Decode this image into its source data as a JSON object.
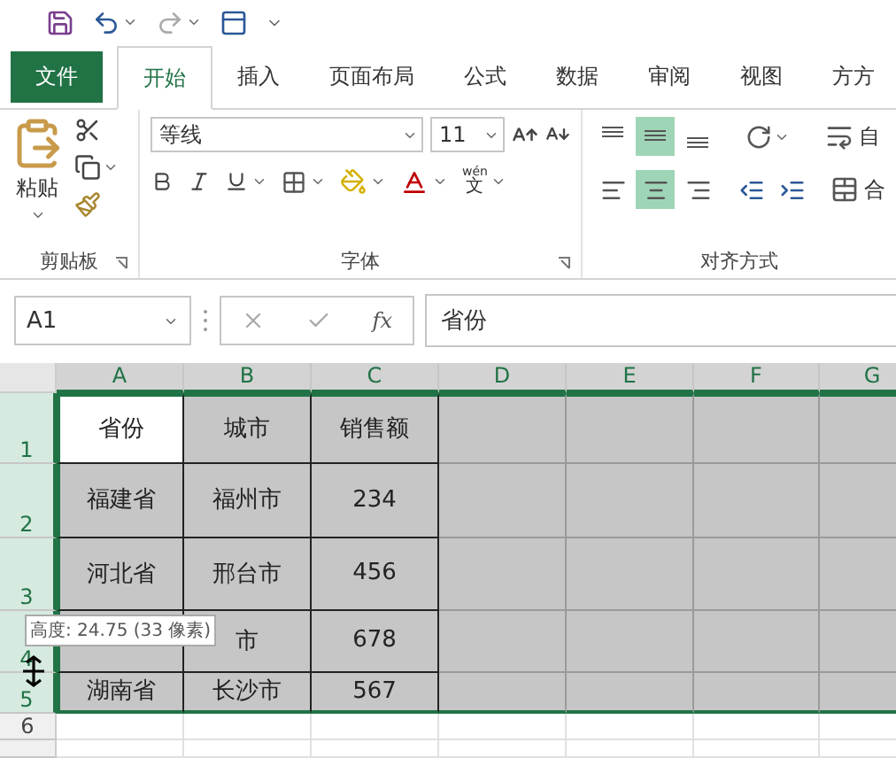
{
  "tabs": [
    {
      "label": "文件",
      "kind": "file",
      "selected": false
    },
    {
      "label": "开始",
      "kind": "tab",
      "selected": true
    },
    {
      "label": "插入",
      "kind": "tab",
      "selected": false
    },
    {
      "label": "页面布局",
      "kind": "tab",
      "selected": false
    },
    {
      "label": "公式",
      "kind": "tab",
      "selected": false
    },
    {
      "label": "数据",
      "kind": "tab",
      "selected": false
    },
    {
      "label": "审阅",
      "kind": "tab",
      "selected": false
    },
    {
      "label": "视图",
      "kind": "tab",
      "selected": false
    },
    {
      "label": "方方",
      "kind": "tab",
      "selected": false
    }
  ],
  "ribbon": {
    "clipboard": {
      "paste_label": "粘贴",
      "group_label": "剪贴板"
    },
    "font": {
      "font_name": "等线",
      "font_size": "11",
      "phonetic_top": "wén",
      "phonetic_bottom": "文",
      "group_label": "字体"
    },
    "alignment": {
      "vertical": [
        {
          "selected": false
        },
        {
          "selected": true
        },
        {
          "selected": false
        }
      ],
      "horizontal": [
        {
          "selected": false
        },
        {
          "selected": true
        },
        {
          "selected": false
        }
      ],
      "wrap_label": "自",
      "merge_label": "合",
      "group_label": "对齐方式"
    }
  },
  "formula_bar": {
    "name_box": "A1",
    "function_symbol": "fx",
    "formula": "省份"
  },
  "sheet": {
    "columns": [
      {
        "label": "A",
        "selected": true
      },
      {
        "label": "B",
        "selected": true
      },
      {
        "label": "C",
        "selected": true
      },
      {
        "label": "D",
        "selected": true
      },
      {
        "label": "E",
        "selected": true
      },
      {
        "label": "F",
        "selected": true
      },
      {
        "label": "G",
        "selected": true
      }
    ],
    "rows": [
      {
        "header": "1",
        "selected": true,
        "cells": [
          {
            "text": "省份",
            "active": true
          },
          {
            "text": "城市",
            "active": false
          },
          {
            "text": "销售额",
            "active": false
          }
        ]
      },
      {
        "header": "2",
        "selected": true,
        "cells": [
          {
            "text": "福建省",
            "active": false
          },
          {
            "text": "福州市",
            "active": false
          },
          {
            "text": "234",
            "active": false
          }
        ]
      },
      {
        "header": "3",
        "selected": true,
        "cells": [
          {
            "text": "河北省",
            "active": false
          },
          {
            "text": "邢台市",
            "active": false
          },
          {
            "text": "456",
            "active": false
          }
        ]
      },
      {
        "header": "4",
        "selected": true,
        "cells": [
          {
            "active": false
          },
          {
            "text": "市",
            "active": false
          },
          {
            "text": "678",
            "active": false
          }
        ]
      },
      {
        "header": "5",
        "selected": true,
        "cells": [
          {
            "text": "湖南省",
            "active": false
          },
          {
            "text": "长沙市",
            "active": false
          },
          {
            "text": "567",
            "active": false
          }
        ]
      },
      {
        "header": "6",
        "selected": false,
        "cells": []
      }
    ]
  },
  "tooltip": {
    "text": "高度: 24.75 (33 像素)"
  }
}
